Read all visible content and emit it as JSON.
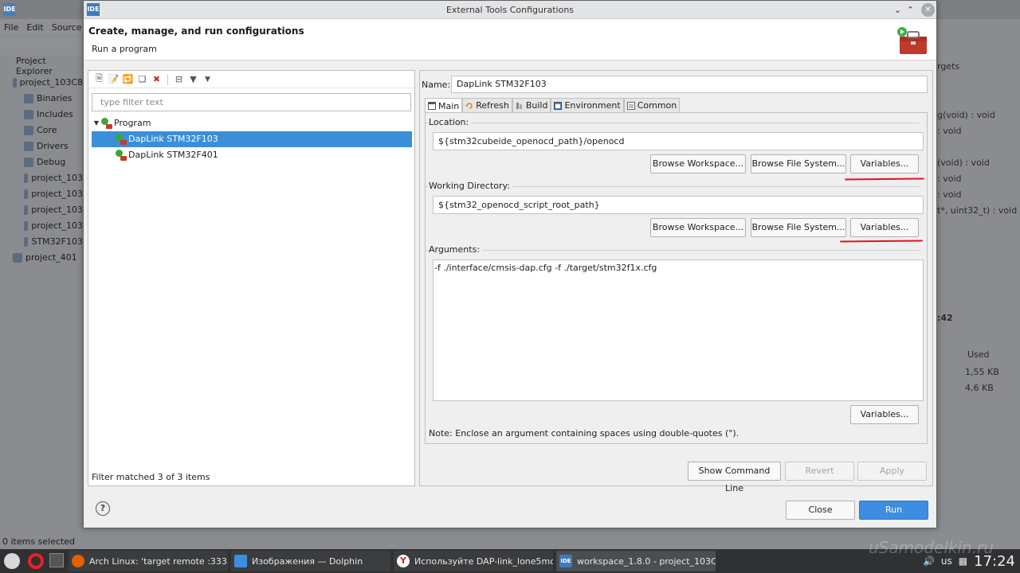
{
  "background_ide": {
    "menu": [
      "File",
      "Edit",
      "Source",
      "R"
    ],
    "project_explorer_title": "Project Explorer",
    "tree": [
      {
        "label": "project_103C8",
        "icon": "ide-project-icon"
      },
      {
        "label": "Binaries",
        "icon": "binaries-icon"
      },
      {
        "label": "Includes",
        "icon": "includes-icon"
      },
      {
        "label": "Core",
        "icon": "folder-icon"
      },
      {
        "label": "Drivers",
        "icon": "folder-icon"
      },
      {
        "label": "Debug",
        "icon": "folder-icon"
      },
      {
        "label": "project_103",
        "icon": "mx-file-icon"
      },
      {
        "label": "project_103",
        "icon": "file-icon"
      },
      {
        "label": "project_103",
        "icon": "file-icon"
      },
      {
        "label": "project_103",
        "icon": "file-icon"
      },
      {
        "label": "STM32F103",
        "icon": "file-icon"
      },
      {
        "label": "project_401",
        "icon": "ide-project-icon"
      }
    ],
    "right_texts": {
      "targets": "rgets",
      "void1": "g(void) : void",
      "void2": ": void",
      "void3": "(void) : void",
      "void4": ": void",
      "void5": ": void",
      "uint": "t*, uint32_t) : void",
      "time": ":42",
      "used_header": "Used",
      "size1": "1,55 KB",
      "size2": "4,6 KB"
    },
    "status": "0 items selected"
  },
  "dialog": {
    "title": "External Tools Configurations",
    "header_title": "Create, manage, and run configurations",
    "header_subtitle": "Run a program",
    "filter_placeholder": "type filter text",
    "tree": {
      "category": "Program",
      "items": [
        "DapLink STM32F103",
        "DapLink STM32F401"
      ],
      "selected_index": 0
    },
    "filter_status": "Filter matched 3 of 3 items",
    "name_label": "Name:",
    "name_value": "DapLink STM32F103",
    "tabs": [
      "Main",
      "Refresh",
      "Build",
      "Environment",
      "Common"
    ],
    "active_tab": "Main",
    "location_label": "Location:",
    "location_value": "${stm32cubeide_openocd_path}/openocd",
    "working_dir_label": "Working Directory:",
    "working_dir_value": "${stm32_openocd_script_root_path}",
    "arguments_label": "Arguments:",
    "arguments_value": "-f ./interface/cmsis-dap.cfg -f ./target/stm32f1x.cfg",
    "browse_workspace": "Browse Workspace...",
    "browse_file_system": "Browse File System...",
    "variables": "Variables...",
    "note": "Note: Enclose an argument containing spaces using double-quotes (\").",
    "show_command_line": "Show Command Line",
    "revert": "Revert",
    "apply": "Apply",
    "close": "Close",
    "run": "Run",
    "help": "?"
  },
  "taskbar": {
    "apps": [
      {
        "label": "Arch Linux: 'target remote :3333' ...",
        "icon": "firefox-icon"
      },
      {
        "label": "Изображения — Dolphin",
        "icon": "dolphin-icon"
      },
      {
        "label": "Используйте DAP-link_lone5moo...",
        "icon": "yandex-browser-icon"
      },
      {
        "label": "workspace_1.8.0 - project_103C8T...",
        "icon": "ide-icon"
      }
    ],
    "keyboard_layout": "us",
    "clock": "17:24",
    "watermark": "uSamodelkin.ru"
  },
  "colors": {
    "selection": "#3a8fd8",
    "primary_button": "#3d8ee0",
    "annotation_red": "#e0141e"
  }
}
